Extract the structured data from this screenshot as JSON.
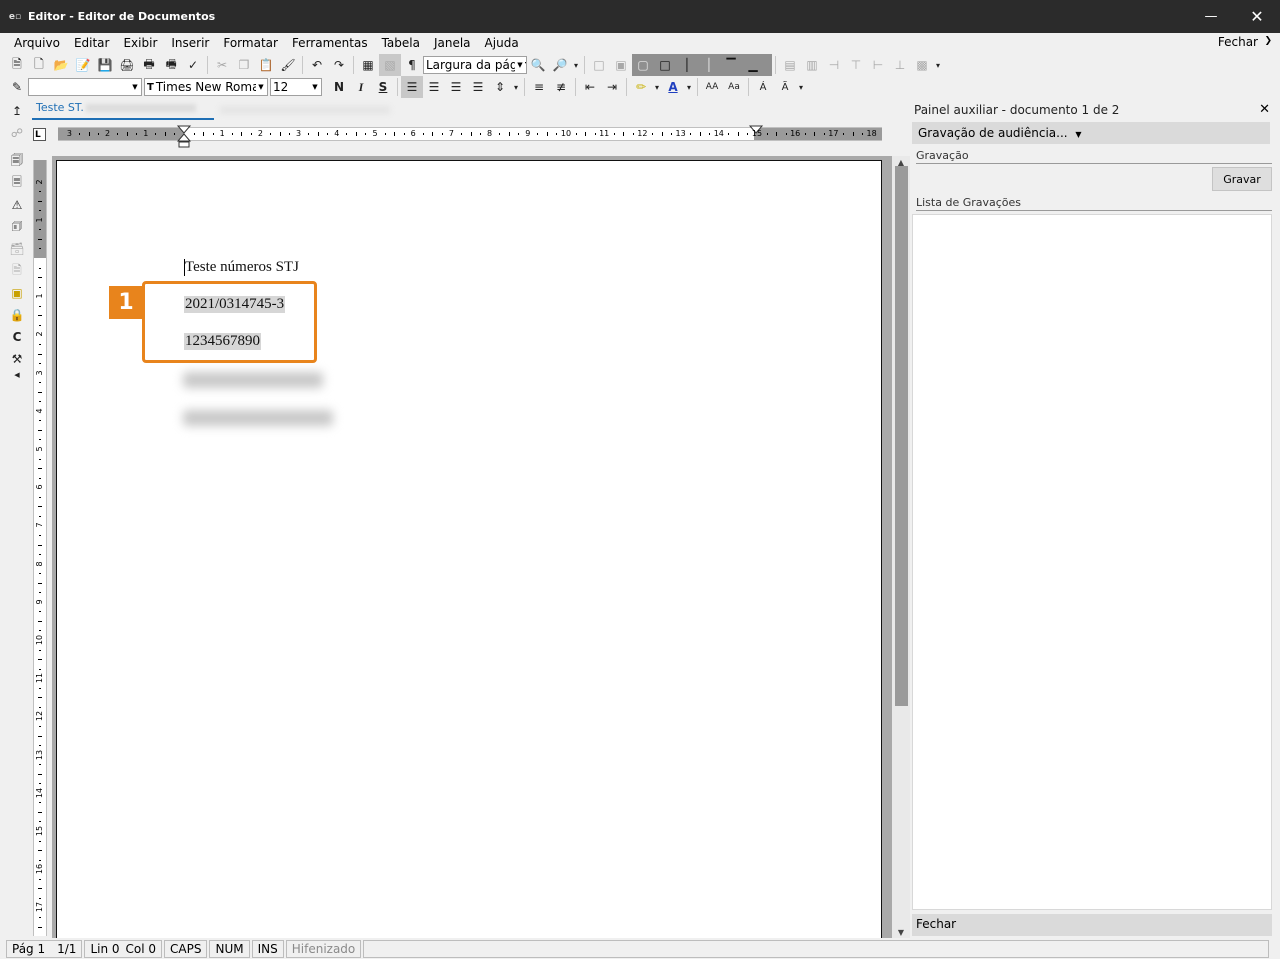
{
  "window": {
    "title": "Editor - Editor de Documentos",
    "app_icon": "app-icon"
  },
  "menu": {
    "items": [
      "Arquivo",
      "Editar",
      "Exibir",
      "Inserir",
      "Formatar",
      "Ferramentas",
      "Tabela",
      "Janela",
      "Ajuda"
    ],
    "fechar": "Fechar"
  },
  "toolbar": {
    "zoom_value": "Largura da págin",
    "style_value": "",
    "font_value": "Times New Romar",
    "size_value": "12",
    "bold_label": "N",
    "italic_label": "I",
    "underline_label": "S",
    "pilcrow": "¶"
  },
  "document_tab": {
    "label": "Teste ST."
  },
  "ruler": {
    "h_numbers": [
      "3",
      "2",
      "1",
      "1",
      "2",
      "3",
      "4",
      "5",
      "6",
      "7",
      "8",
      "9",
      "10",
      "11",
      "12",
      "13",
      "14",
      "15",
      "16",
      "17",
      "18"
    ],
    "v_numbers": [
      "2",
      "1",
      "1",
      "2",
      "3",
      "4",
      "5",
      "6",
      "7",
      "8",
      "9",
      "10",
      "11",
      "12",
      "13",
      "14",
      "15",
      "16",
      "17"
    ]
  },
  "document": {
    "lines": [
      "Teste números STJ",
      "2021/0314745-3",
      "1234567890"
    ]
  },
  "callout": {
    "number": "1",
    "color": "#e8841c"
  },
  "panel": {
    "header": "Painel auxiliar - documento 1 de 2",
    "close": "✕",
    "dropdown": "Gravação de audiência...",
    "section_gravacao": "Gravação",
    "gravar_button": "Gravar",
    "section_lista": "Lista de Gravações",
    "footer": "Fechar"
  },
  "status": {
    "page": "Pág 1",
    "pages": "1/1",
    "line": "Lin 0",
    "col": "Col 0",
    "caps": "CAPS",
    "num": "NUM",
    "ins": "INS",
    "hyphen": "Hifenizado"
  }
}
